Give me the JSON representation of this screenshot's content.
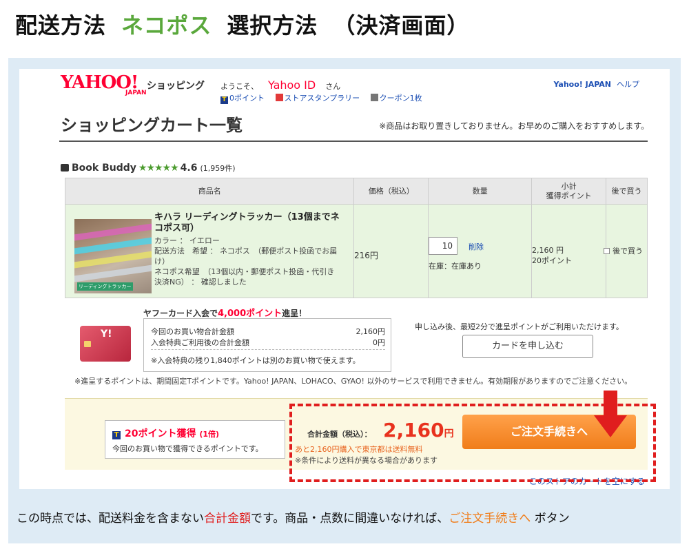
{
  "title": {
    "part1": "配送方法",
    "part2": "ネコポス",
    "part3": "選択方法",
    "part4": "（決済画面）"
  },
  "header": {
    "logo": "YAHOO!",
    "logo_sub": "JAPAN",
    "shop_label": "ショッピング",
    "welcome_prefix": "ようこそ、",
    "user_id": "Yahoo ID",
    "welcome_suffix": "さん",
    "points_link": "0ポイント",
    "stamp_link": "ストアスタンプラリー",
    "coupon_link": "クーポン1枚",
    "yahoo_japan_link": "Yahoo! JAPAN",
    "help_link": "ヘルプ"
  },
  "page_heading": "ショッピングカート一覧",
  "notice": "※商品はお取り置きしておりません。お早めのご購入をおすすめします。",
  "store": {
    "name": "Book Buddy",
    "stars": "★★★★★",
    "rating": "4.6",
    "count": "(1,959件)"
  },
  "table": {
    "headers": [
      "商品名",
      "価格（税込）",
      "数量",
      "小計\n獲得ポイント",
      "後で買う"
    ],
    "item": {
      "name": "キハラ リーディングトラッカー（13個までネコポス可）",
      "color": "カラー ： イエロー",
      "shipping": "配送方法　希望 ： ネコポス　（郵便ポスト投函でお届け）",
      "note": "ネコポス希望　（13個以内・郵便ポスト投函・代引き決済NG） ： 確認しました",
      "thumb_tag": "リーディングトラッカー",
      "price": "216円",
      "qty": "10",
      "delete": "削除",
      "stock": "在庫：在庫あり",
      "subtotal": "2,160 円",
      "points": "20ポイント",
      "later": "後で買う"
    }
  },
  "promo": {
    "title_prefix": "ヤフーカード入会で",
    "title_points": "4,000ポイント",
    "title_suffix": "進呈！",
    "row1_label": "今回のお買い物合計金額",
    "row1_value": "2,160円",
    "row2_label": "入会特典ご利用後の合計金額",
    "row2_value": "0円",
    "footnote": "※入会特典の残り1,840ポイントは別のお買い物で使えます。",
    "apply_text": "申し込み後、最短2分で進呈ポイントがご利用いただけます。",
    "apply_button": "カードを申し込む",
    "card_mark": "Y!",
    "points_note": "※進呈するポイントは、期間固定Tポイントです。Yahoo! JAPAN、LOHACO、GYAO! 以外のサービスで利用できません。有効期限がありますのでご注意ください。"
  },
  "summary": {
    "points_badge": "T",
    "points_title": "20ポイント獲得",
    "points_mult": "(1倍)",
    "points_sub": "今回のお買い物で獲得できるポイントです。",
    "total_label": "合計金額（税込）：",
    "total_value": "2,160",
    "total_unit": "円",
    "free_ship": "あと2,160円購入で東京都は送料無料",
    "ship_cond": "※条件により送料が異なる場合があります",
    "checkout_button": "ご注文手続きへ",
    "clear_cart": "このストアのカートを空にする"
  },
  "caption": {
    "part1": "この時点では、配送料金を含まない",
    "part2": "合計金額",
    "part3": "です。商品・点数に間違いなければ、",
    "part4": "ご注文手続きへ",
    "part5": " ボタン"
  },
  "colors": {
    "accent_green": "#5aa83c",
    "highlight_red": "#e01e1e",
    "checkout_orange": "#f07d1a",
    "link_blue": "#1a4db3"
  }
}
